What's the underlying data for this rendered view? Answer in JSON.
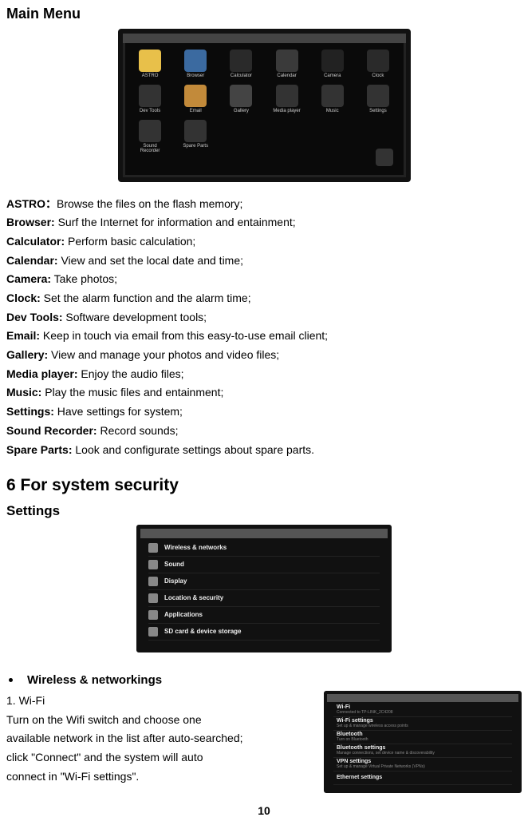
{
  "heading_main_menu": "Main Menu",
  "tablet_apps": [
    {
      "name": "ASTRO",
      "color": "#e8c04a"
    },
    {
      "name": "Browser",
      "color": "#3b6aa0"
    },
    {
      "name": "Calculator",
      "color": "#2a2a2a"
    },
    {
      "name": "Calendar",
      "color": "#3a3a3a"
    },
    {
      "name": "Camera",
      "color": "#222"
    },
    {
      "name": "Clock",
      "color": "#2a2a2a"
    },
    {
      "name": "Dev Tools",
      "color": "#333"
    },
    {
      "name": "Email",
      "color": "#c28a3a"
    },
    {
      "name": "Gallery",
      "color": "#444"
    },
    {
      "name": "Media player",
      "color": "#333"
    },
    {
      "name": "Music",
      "color": "#333"
    },
    {
      "name": "Settings",
      "color": "#333"
    },
    {
      "name": "Sound Recorder",
      "color": "#333"
    },
    {
      "name": "Spare Parts",
      "color": "#333"
    }
  ],
  "definitions": [
    {
      "term": "ASTRO：",
      "desc": "Browse the files on the flash memory;"
    },
    {
      "term": "Browser:",
      "desc": " Surf the Internet for information and entainment;"
    },
    {
      "term": "Calculator:",
      "desc": " Perform basic calculation;"
    },
    {
      "term": "Calendar:",
      "desc": " View and set the local date and time;"
    },
    {
      "term": "Camera:",
      "desc": " Take photos;"
    },
    {
      "term": "Clock:",
      "desc": " Set the alarm function and the alarm time;"
    },
    {
      "term": "Dev Tools:",
      "desc": " Software development tools;"
    },
    {
      "term": "Email:",
      "desc": " Keep in touch via email from this easy-to-use email client;"
    },
    {
      "term": "Gallery:",
      "desc": " View and manage your photos and video files;"
    },
    {
      "term": "Media player:",
      "desc": " Enjoy the audio files;"
    },
    {
      "term": "Music:",
      "desc": " Play the music files and entainment;"
    },
    {
      "term": "Settings:",
      "desc": " Have settings for system;"
    },
    {
      "term": "Sound Recorder:",
      "desc": " Record sounds;"
    },
    {
      "term": "Spare Parts:",
      "desc": " Look and configurate settings about spare parts."
    }
  ],
  "heading_section6": "6 For system security",
  "heading_settings": "Settings",
  "settings_rows": [
    "Wireless & networks",
    "Sound",
    "Display",
    "Location & security",
    "Applications",
    "SD card & device storage"
  ],
  "bullet_wireless": "Wireless & networkings",
  "wifi_title": "1. Wi-Fi",
  "wifi_para1": "Turn on the Wifi switch and choose one",
  "wifi_para2": "available network in the list after auto-searched;",
  "wifi_para3": "click \"Connect\" and the system will auto",
  "wifi_para4": "connect in \"Wi-Fi settings\".",
  "wifi_rows": [
    {
      "t": "Wi-Fi",
      "s": "Connected to TP-LINK_2C4208"
    },
    {
      "t": "Wi-Fi settings",
      "s": "Set up & manage wireless access points"
    },
    {
      "t": "Bluetooth",
      "s": "Turn on Bluetooth"
    },
    {
      "t": "Bluetooth settings",
      "s": "Manage connections, set device name & discoverability"
    },
    {
      "t": "VPN settings",
      "s": "Set up & manage Virtual Private Networks (VPNs)"
    },
    {
      "t": "Ethernet settings",
      "s": ""
    }
  ],
  "page_number": "10"
}
